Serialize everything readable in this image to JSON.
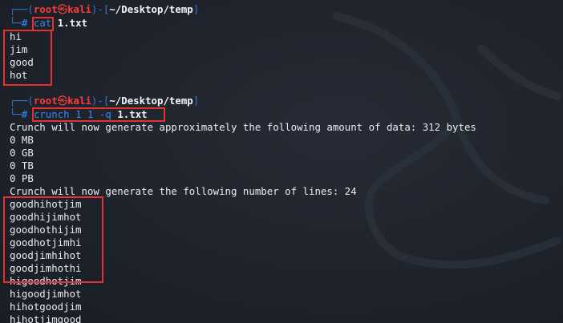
{
  "prompt": {
    "open": "┌──(",
    "user": "root",
    "at": "㉿",
    "host": "kali",
    "mid": ")-[",
    "path": "~/Desktop/temp",
    "close": "]",
    "hash_prefix": "└─",
    "hash": "#"
  },
  "block1": {
    "command": "cat",
    "argument": "1.txt",
    "output": [
      "hi",
      "jim",
      "good",
      "hot"
    ]
  },
  "block2": {
    "command": "crunch 1 1 -q",
    "argument": "1.txt",
    "output": [
      "Crunch will now generate approximately the following amount of data: 312 bytes",
      "0 MB",
      "0 GB",
      "0 TB",
      "0 PB",
      "Crunch will now generate the following number of lines: 24",
      "goodhihotjim",
      "goodhijimhot",
      "goodhothijim",
      "goodhotjimhi",
      "goodjimhihot",
      "goodjimhothi",
      "higoodhotjim",
      "higoodjimhot",
      "hihotgoodjim",
      "hihotjimgood"
    ]
  },
  "colors": {
    "background": "#1f232b",
    "prompt_frame": "#2f78d6",
    "root_user": "#ff3b3b",
    "highlight_box": "#e53030"
  }
}
